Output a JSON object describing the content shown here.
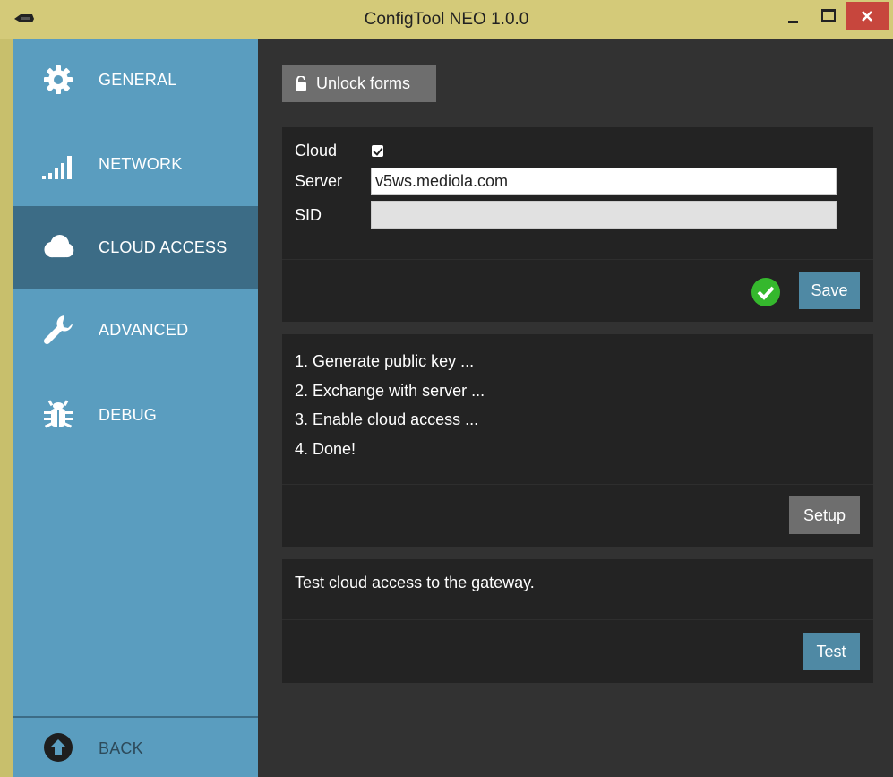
{
  "window": {
    "title": "ConfigTool NEO 1.0.0",
    "colors": {
      "titlebar": "#d4ca79",
      "close": "#c7463d"
    }
  },
  "sidebar": {
    "items": [
      {
        "label": "GENERAL",
        "icon": "gear-icon",
        "active": false
      },
      {
        "label": "NETWORK",
        "icon": "signal-bars-icon",
        "active": false
      },
      {
        "label": "CLOUD ACCESS",
        "icon": "cloud-icon",
        "active": true
      },
      {
        "label": "ADVANCED",
        "icon": "wrench-icon",
        "active": false
      },
      {
        "label": "DEBUG",
        "icon": "bug-icon",
        "active": false
      }
    ],
    "back": {
      "label": "BACK",
      "icon": "arrow-up-circle-icon"
    },
    "colors": {
      "background": "#5a9dbf",
      "active": "#3c6c86"
    }
  },
  "main": {
    "unlock_label": "Unlock forms",
    "cloud_form": {
      "cloud_label": "Cloud",
      "cloud_checked": true,
      "server_label": "Server",
      "server_value": "v5ws.mediola.com",
      "sid_label": "SID",
      "sid_value": "",
      "status_icon": "check-circle-icon",
      "save_label": "Save"
    },
    "setup_panel": {
      "steps": [
        "1. Generate public key ...",
        "2. Exchange with server ...",
        "3. Enable cloud access ...",
        "4. Done!"
      ],
      "setup_label": "Setup"
    },
    "test_panel": {
      "text": "Test cloud access to the gateway.",
      "test_label": "Test"
    },
    "colors": {
      "background": "#323232",
      "panel": "#232323",
      "accent_button": "#4f89a4",
      "grey_button": "#6e6e6e",
      "ok": "#35b82d"
    }
  }
}
